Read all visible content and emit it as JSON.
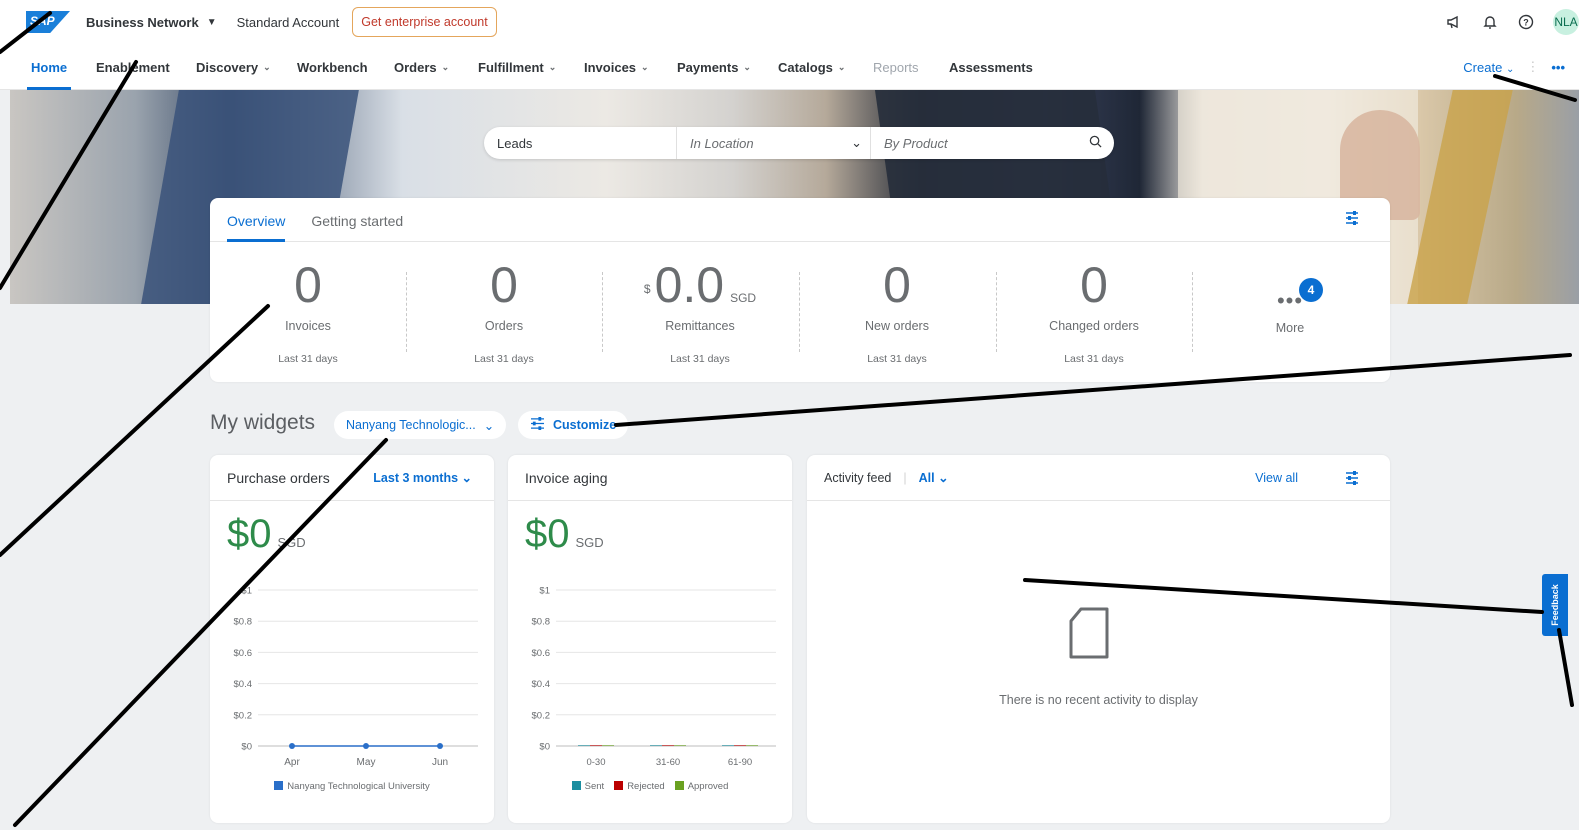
{
  "shell": {
    "logo_text": "SAP",
    "app_name": "Business Network",
    "account_type": "Standard Account",
    "enterprise_button": "Get enterprise account",
    "avatar_initials": "NLA"
  },
  "nav": {
    "items": [
      {
        "label": "Home"
      },
      {
        "label": "Enablement"
      },
      {
        "label": "Discovery"
      },
      {
        "label": "Workbench"
      },
      {
        "label": "Orders"
      },
      {
        "label": "Fulfillment"
      },
      {
        "label": "Invoices"
      },
      {
        "label": "Payments"
      },
      {
        "label": "Catalogs"
      },
      {
        "label": "Reports"
      },
      {
        "label": "Assessments"
      }
    ],
    "create_label": "Create"
  },
  "search": {
    "leads": "Leads",
    "location_placeholder": "In Location",
    "product_placeholder": "By Product"
  },
  "overview": {
    "tabs": [
      "Overview",
      "Getting started"
    ],
    "tiles": [
      {
        "value": "0",
        "label": "Invoices",
        "period": "Last 31 days"
      },
      {
        "value": "0",
        "label": "Orders",
        "period": "Last 31 days"
      },
      {
        "currency": "$",
        "value": "0.0",
        "unit": "SGD",
        "label": "Remittances",
        "period": "Last 31 days"
      },
      {
        "value": "0",
        "label": "New orders",
        "period": "Last 31 days"
      },
      {
        "value": "0",
        "label": "Changed orders",
        "period": "Last 31 days"
      },
      {
        "dots": "•••",
        "label": "More",
        "badge": "4"
      }
    ]
  },
  "widgets": {
    "title": "My widgets",
    "org_select": "Nanyang Technologic...",
    "customize": "Customize",
    "purchase_orders": {
      "title": "Purchase orders",
      "range": "Last 3 months",
      "amount": "$0",
      "unit": "SGD",
      "legend": "Nanyang Technological University"
    },
    "invoice_aging": {
      "title": "Invoice aging",
      "amount": "$0",
      "unit": "SGD",
      "legend": [
        "Sent",
        "Rejected",
        "Approved"
      ]
    },
    "activity": {
      "title": "Activity feed",
      "filter": "All",
      "view_all": "View all",
      "empty": "There is no recent activity to display"
    }
  },
  "feedback_label": "Feedback",
  "colors": {
    "accent": "#0a6ed1",
    "amount_green": "#2e8b4a",
    "sent": "#1b8ea0",
    "rejected": "#bb0000",
    "approved": "#6aa121",
    "po_series": "#2a6fc9"
  },
  "chart_data": [
    {
      "type": "line",
      "x": [
        "Apr",
        "May",
        "Jun"
      ],
      "yticks": [
        "$0",
        "$0.2",
        "$0.4",
        "$0.6",
        "$0.8",
        "$1"
      ],
      "ylim": [
        0,
        1
      ],
      "series": [
        {
          "name": "Nanyang Technological University",
          "values": [
            0,
            0,
            0
          ]
        }
      ],
      "legend": "bottom"
    },
    {
      "type": "bar",
      "categories": [
        "0-30",
        "31-60",
        "61-90"
      ],
      "yticks": [
        "$0",
        "$0.2",
        "$0.4",
        "$0.6",
        "$0.8",
        "$1"
      ],
      "ylim": [
        0,
        1
      ],
      "series": [
        {
          "name": "Sent",
          "values": [
            0,
            0,
            0
          ]
        },
        {
          "name": "Rejected",
          "values": [
            0,
            0,
            0
          ]
        },
        {
          "name": "Approved",
          "values": [
            0,
            0,
            0
          ]
        }
      ],
      "legend": "bottom"
    }
  ]
}
